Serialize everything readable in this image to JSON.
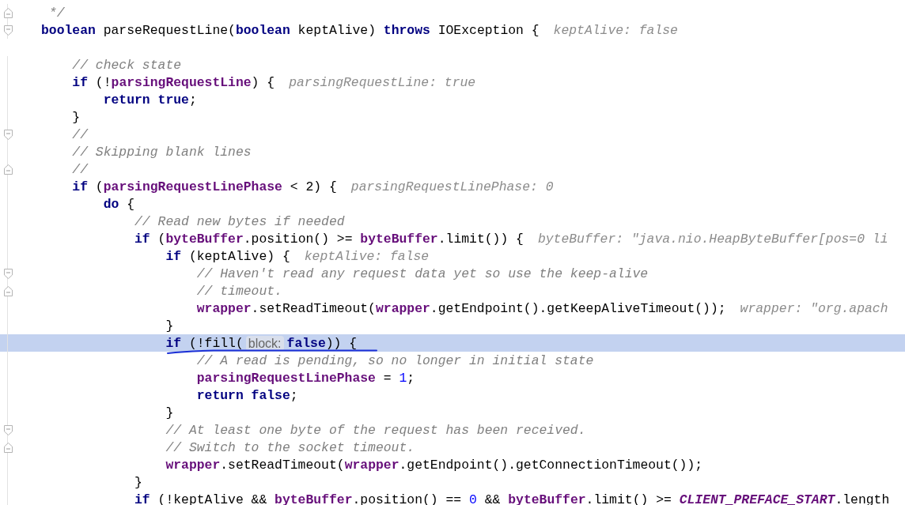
{
  "lines": [
    {
      "kind": "code",
      "fold_end": true,
      "segments": [
        {
          "kind": "code",
          "tokens": [
            {
              "kind": "comment",
              "t": " */"
            }
          ]
        }
      ]
    },
    {
      "kind": "code",
      "fold_start": true,
      "segments": [
        {
          "kind": "code",
          "tokens": [
            {
              "kind": "kw",
              "t": "boolean"
            },
            {
              "kind": "plain",
              "t": " parseRequestLine("
            },
            {
              "kind": "kw",
              "t": "boolean"
            },
            {
              "kind": "plain",
              "t": " keptAlive) "
            },
            {
              "kind": "kw",
              "t": "throws"
            },
            {
              "kind": "plain",
              "t": " IOException {"
            }
          ]
        },
        {
          "kind": "hint",
          "text": "keptAlive: false"
        }
      ],
      "children": [
        {
          "kind": "blank"
        },
        {
          "kind": "code",
          "segments": [
            {
              "kind": "code",
              "tokens": [
                {
                  "kind": "comment",
                  "t": "// check state"
                }
              ]
            }
          ]
        },
        {
          "kind": "code",
          "segments": [
            {
              "kind": "code",
              "tokens": [
                {
                  "kind": "kw",
                  "t": "if"
                },
                {
                  "kind": "plain",
                  "t": " (!"
                },
                {
                  "kind": "field",
                  "t": "parsingRequestLine"
                },
                {
                  "kind": "plain",
                  "t": ") {"
                }
              ]
            },
            {
              "kind": "hint",
              "text": "parsingRequestLine: true"
            }
          ],
          "children": [
            {
              "kind": "code",
              "segments": [
                {
                  "kind": "code",
                  "tokens": [
                    {
                      "kind": "kw",
                      "t": "return true"
                    },
                    {
                      "kind": "plain",
                      "t": ";"
                    }
                  ]
                }
              ]
            }
          ]
        },
        {
          "kind": "code",
          "segments": [
            {
              "kind": "code",
              "tokens": [
                {
                  "kind": "plain",
                  "t": "}"
                }
              ]
            }
          ]
        },
        {
          "kind": "code",
          "fold_start": true,
          "segments": [
            {
              "kind": "code",
              "tokens": [
                {
                  "kind": "comment",
                  "t": "//"
                }
              ]
            }
          ]
        },
        {
          "kind": "code",
          "segments": [
            {
              "kind": "code",
              "tokens": [
                {
                  "kind": "comment",
                  "t": "// Skipping blank lines"
                }
              ]
            }
          ]
        },
        {
          "kind": "code",
          "fold_end": true,
          "segments": [
            {
              "kind": "code",
              "tokens": [
                {
                  "kind": "comment",
                  "t": "//"
                }
              ]
            }
          ]
        },
        {
          "kind": "code",
          "segments": [
            {
              "kind": "code",
              "tokens": [
                {
                  "kind": "kw",
                  "t": "if"
                },
                {
                  "kind": "plain",
                  "t": " ("
                },
                {
                  "kind": "field",
                  "t": "parsingRequestLinePhase"
                },
                {
                  "kind": "plain",
                  "t": " < 2) {"
                }
              ]
            },
            {
              "kind": "hint",
              "text": "parsingRequestLinePhase: 0"
            }
          ],
          "children": [
            {
              "kind": "code",
              "segments": [
                {
                  "kind": "code",
                  "tokens": [
                    {
                      "kind": "kw",
                      "t": "do"
                    },
                    {
                      "kind": "plain",
                      "t": " {"
                    }
                  ]
                }
              ],
              "children": [
                {
                  "kind": "code",
                  "segments": [
                    {
                      "kind": "code",
                      "tokens": [
                        {
                          "kind": "comment",
                          "t": "// Read new bytes if needed"
                        }
                      ]
                    }
                  ]
                },
                {
                  "kind": "code",
                  "segments": [
                    {
                      "kind": "code",
                      "tokens": [
                        {
                          "kind": "kw",
                          "t": "if"
                        },
                        {
                          "kind": "plain",
                          "t": " ("
                        },
                        {
                          "kind": "field",
                          "t": "byteBuffer"
                        },
                        {
                          "kind": "plain",
                          "t": ".position() >= "
                        },
                        {
                          "kind": "field",
                          "t": "byteBuffer"
                        },
                        {
                          "kind": "plain",
                          "t": ".limit()) {"
                        }
                      ]
                    },
                    {
                      "kind": "hint",
                      "text": "byteBuffer: \"java.nio.HeapByteBuffer[pos=0 li"
                    }
                  ],
                  "children": [
                    {
                      "kind": "code",
                      "segments": [
                        {
                          "kind": "code",
                          "tokens": [
                            {
                              "kind": "kw",
                              "t": "if"
                            },
                            {
                              "kind": "plain",
                              "t": " (keptAlive) {"
                            }
                          ]
                        },
                        {
                          "kind": "hint",
                          "text": "keptAlive: false"
                        }
                      ],
                      "children": [
                        {
                          "kind": "code",
                          "fold_start": true,
                          "segments": [
                            {
                              "kind": "code",
                              "tokens": [
                                {
                                  "kind": "comment",
                                  "t": "// Haven't read any request data yet so use the keep-alive"
                                }
                              ]
                            }
                          ]
                        },
                        {
                          "kind": "code",
                          "fold_end": true,
                          "segments": [
                            {
                              "kind": "code",
                              "tokens": [
                                {
                                  "kind": "comment",
                                  "t": "// timeout."
                                }
                              ]
                            }
                          ]
                        },
                        {
                          "kind": "code",
                          "segments": [
                            {
                              "kind": "code",
                              "tokens": [
                                {
                                  "kind": "field",
                                  "t": "wrapper"
                                },
                                {
                                  "kind": "plain",
                                  "t": ".setReadTimeout("
                                },
                                {
                                  "kind": "field",
                                  "t": "wrapper"
                                },
                                {
                                  "kind": "plain",
                                  "t": ".getEndpoint().getKeepAliveTimeout());"
                                }
                              ]
                            },
                            {
                              "kind": "hint",
                              "text": "wrapper: \"org.apach"
                            }
                          ]
                        }
                      ]
                    },
                    {
                      "kind": "code",
                      "segments": [
                        {
                          "kind": "code",
                          "tokens": [
                            {
                              "kind": "plain",
                              "t": "}"
                            }
                          ]
                        }
                      ]
                    },
                    {
                      "kind": "code",
                      "current": true,
                      "underlined": true,
                      "segments": [
                        {
                          "kind": "code",
                          "tokens": [
                            {
                              "kind": "kw",
                              "t": "if"
                            },
                            {
                              "kind": "plain",
                              "t": " (!fill("
                            }
                          ]
                        },
                        {
                          "kind": "param",
                          "text": "block:"
                        },
                        {
                          "kind": "code",
                          "tokens": [
                            {
                              "kind": "kw",
                              "t": "false"
                            },
                            {
                              "kind": "plain",
                              "t": ")) {"
                            }
                          ]
                        }
                      ],
                      "children": [
                        {
                          "kind": "code",
                          "segments": [
                            {
                              "kind": "code",
                              "tokens": [
                                {
                                  "kind": "comment",
                                  "t": "// A read is pending, so no longer in initial state"
                                }
                              ]
                            }
                          ]
                        },
                        {
                          "kind": "code",
                          "segments": [
                            {
                              "kind": "code",
                              "tokens": [
                                {
                                  "kind": "field",
                                  "t": "parsingRequestLinePhase"
                                },
                                {
                                  "kind": "plain",
                                  "t": " = "
                                },
                                {
                                  "kind": "num",
                                  "t": "1"
                                },
                                {
                                  "kind": "plain",
                                  "t": ";"
                                }
                              ]
                            }
                          ]
                        },
                        {
                          "kind": "code",
                          "segments": [
                            {
                              "kind": "code",
                              "tokens": [
                                {
                                  "kind": "kw",
                                  "t": "return false"
                                },
                                {
                                  "kind": "plain",
                                  "t": ";"
                                }
                              ]
                            }
                          ]
                        }
                      ]
                    },
                    {
                      "kind": "code",
                      "segments": [
                        {
                          "kind": "code",
                          "tokens": [
                            {
                              "kind": "plain",
                              "t": "}"
                            }
                          ]
                        }
                      ]
                    },
                    {
                      "kind": "code",
                      "fold_start": true,
                      "segments": [
                        {
                          "kind": "code",
                          "tokens": [
                            {
                              "kind": "comment",
                              "t": "// At least one byte of the request has been received."
                            }
                          ]
                        }
                      ]
                    },
                    {
                      "kind": "code",
                      "fold_end": true,
                      "segments": [
                        {
                          "kind": "code",
                          "tokens": [
                            {
                              "kind": "comment",
                              "t": "// Switch to the socket timeout."
                            }
                          ]
                        }
                      ]
                    },
                    {
                      "kind": "code",
                      "segments": [
                        {
                          "kind": "code",
                          "tokens": [
                            {
                              "kind": "field",
                              "t": "wrapper"
                            },
                            {
                              "kind": "plain",
                              "t": ".setReadTimeout("
                            },
                            {
                              "kind": "field",
                              "t": "wrapper"
                            },
                            {
                              "kind": "plain",
                              "t": ".getEndpoint().getConnectionTimeout());"
                            }
                          ]
                        }
                      ]
                    }
                  ]
                },
                {
                  "kind": "code",
                  "segments": [
                    {
                      "kind": "code",
                      "tokens": [
                        {
                          "kind": "plain",
                          "t": "}"
                        }
                      ]
                    }
                  ]
                },
                {
                  "kind": "code",
                  "segments": [
                    {
                      "kind": "code",
                      "tokens": [
                        {
                          "kind": "kw",
                          "t": "if"
                        },
                        {
                          "kind": "plain",
                          "t": " (!keptAlive && "
                        },
                        {
                          "kind": "field",
                          "t": "byteBuffer"
                        },
                        {
                          "kind": "plain",
                          "t": ".position() == "
                        },
                        {
                          "kind": "num",
                          "t": "0"
                        },
                        {
                          "kind": "plain",
                          "t": " && "
                        },
                        {
                          "kind": "field",
                          "t": "byteBuffer"
                        },
                        {
                          "kind": "plain",
                          "t": ".limit() >= "
                        },
                        {
                          "kind": "const",
                          "t": "CLIENT_PREFACE_START"
                        },
                        {
                          "kind": "plain",
                          "t": ".length"
                        }
                      ]
                    }
                  ]
                }
              ]
            }
          ]
        }
      ]
    }
  ]
}
